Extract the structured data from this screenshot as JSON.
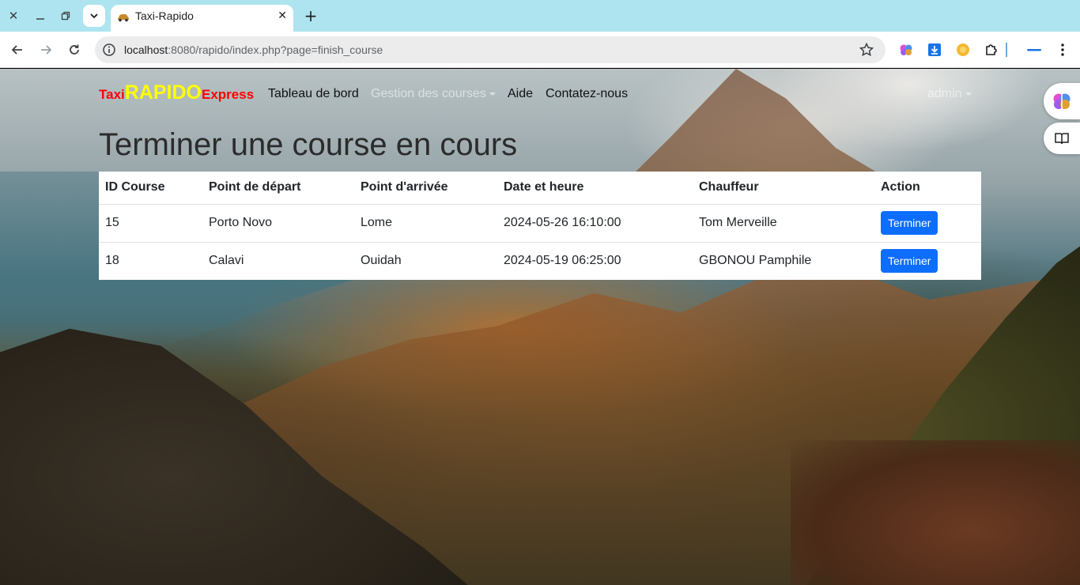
{
  "browser": {
    "tab_title": "Taxi-Rapido",
    "url_host": "localhost",
    "url_rest": ":8080/rapido/index.php?page=finish_course"
  },
  "navbar": {
    "brand": {
      "part1": "Taxi",
      "part2": "RAPIDO",
      "part3": "Express"
    },
    "links": [
      {
        "label": "Tableau de bord"
      },
      {
        "label": "Gestion des courses"
      },
      {
        "label": "Aide"
      },
      {
        "label": "Contatez-nous"
      }
    ],
    "user": "admin"
  },
  "page": {
    "title": "Terminer une course en cours"
  },
  "table": {
    "headers": [
      "ID Course",
      "Point de départ",
      "Point d'arrivée",
      "Date et heure",
      "Chauffeur",
      "Action"
    ],
    "rows": [
      {
        "id": "15",
        "depart": "Porto Novo",
        "arrivee": "Lome",
        "datetime": "2024-05-26 16:10:00",
        "chauffeur": "Tom Merveille",
        "action": "Terminer"
      },
      {
        "id": "18",
        "depart": "Calavi",
        "arrivee": "Ouidah",
        "datetime": "2024-05-19 06:25:00",
        "chauffeur": "GBONOU Pamphile",
        "action": "Terminer"
      }
    ]
  },
  "colors": {
    "brand_red": "#ff0000",
    "brand_yellow": "#ffff00",
    "button_blue": "#0d6efd",
    "tabbar": "#aee4ef"
  }
}
